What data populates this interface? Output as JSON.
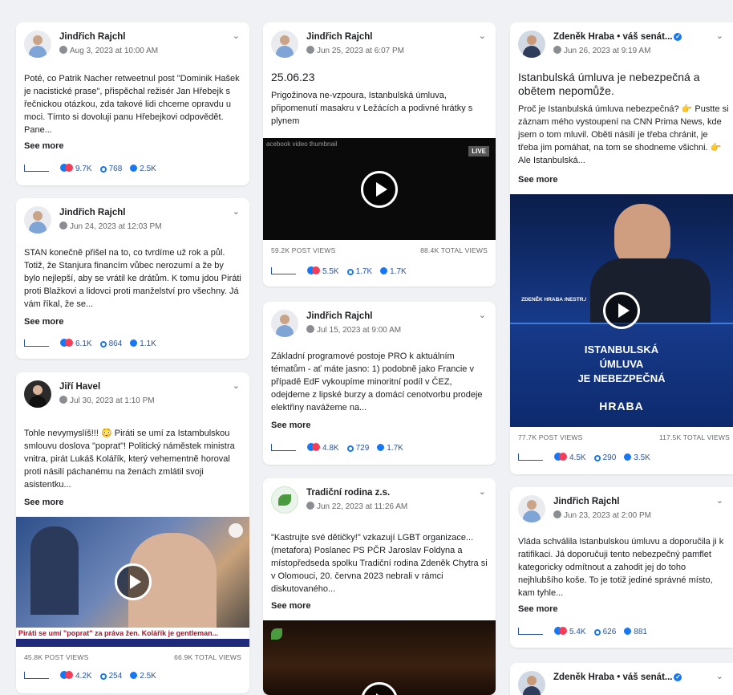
{
  "posts": [
    {
      "author": "Jindřich Rajchl",
      "date": "Aug 3, 2023 at 10:00 AM",
      "text": "Poté, co Patrik Nacher retweetnul post \"Dominik Hašek je nacistické prase\", přispěchal režisér Jan Hřebejk s řečnickou otázkou, zda takové lidi chceme opravdu u moci. Tímto si dovoluji panu Hřebejkovi odpovědět. Pane...",
      "see_more": "See more",
      "reactions": "9.7K",
      "comments": "768",
      "shares": "2.5K"
    },
    {
      "author": "Jindřich Rajchl",
      "date": "Jun 24, 2023 at 12:03 PM",
      "text": "STAN konečně přišel na to, co tvrdíme už rok a půl. Totiž, že Stanjura financím vůbec nerozumí a že by bylo nejlepší, aby se vrátil ke drátům. K tomu jdou Piráti proti Blažkovi a lidovci proti manželství pro všechny. Já vám říkal, že se...",
      "see_more": "See more",
      "reactions": "6.1K",
      "comments": "864",
      "shares": "1.1K"
    },
    {
      "author": "Jiří Havel",
      "date": "Jul 30, 2023 at 1:10 PM",
      "text": "Tohle nevymyslíš!!! 😳 Piráti se umí za Istambulskou smlouvu doslova \"poprat\"! Politický náměstek ministra vnitra, pirát Lukáš Kolářík, který vehementně horoval proti násilí páchanému na ženách zmlátil svoji asistentku...",
      "see_more": "See more",
      "caption": "Piráti se umí \"poprat\" za práva žen. Kolářík je gentleman...",
      "post_views": "45.8K POST VIEWS",
      "total_views": "66.9K TOTAL VIEWS",
      "reactions": "4.2K",
      "comments": "254",
      "shares": "2.5K"
    },
    {
      "author": "Jindřich Rajchl",
      "date": "Jun 25, 2023 at 6:07 PM",
      "title": "25.06.23",
      "text": "Prigožinova ne-vzpoura, Istanbulská úmluva, připomenutí masakru v Ležácích a podivné hrátky s plynem",
      "thumb_label": "acebook video thumbnail",
      "live": "LIVE",
      "post_views": "59.2K POST VIEWS",
      "total_views": "88.4K TOTAL VIEWS",
      "reactions": "5.5K",
      "comments": "1.7K",
      "shares": "1.7K"
    },
    {
      "author": "Jindřich Rajchl",
      "date": "Jul 15, 2023 at 9:00 AM",
      "text": "Základní programové postoje PRO k aktuálním tématům - ať máte jasno: 1) podobně jako Francie v případě EdF vykoupíme minoritní podíl v ČEZ, odejdeme z lipské burzy a domácí cenotvorbu prodeje elektřiny navážeme na...",
      "see_more": "See more",
      "reactions": "4.8K",
      "comments": "729",
      "shares": "1.7K"
    },
    {
      "author": "Tradiční rodina z.s.",
      "date": "Jun 22, 2023 at 11:26 AM",
      "text": "\"Kastrujte své dětičky!\" vzkazují LGBT organizace... (metafora) Poslanec PS PČR Jaroslav Foldyna a místopředseda spolku Tradiční rodina Zdeněk Chytra si v Olomouci, 20. června 2023 nebrali v rámci diskutovaného...",
      "see_more": "See more"
    },
    {
      "author": "Zdeněk Hraba • váš senát...",
      "date": "Jun 26, 2023 at 9:19 AM",
      "title": "Istanbulská úmluva je nebezpečná a obětem nepomůže.",
      "text": "Proč je Istanbulská úmluva nebezpečná? 👉 Pustte si záznam mého vystoupení na CNN Prima News, kde jsem o tom mluvil. Oběti násilí je třeba chránit, je třeba jim pomáhat, na tom se shodneme všichni. 👉 Ale Istanbulská...",
      "see_more": "See more",
      "lower_third": "ZDENĚK HRABA /NESTR./",
      "banner_line1": "ISTANBULSKÁ",
      "banner_line2": "ÚMLUVA",
      "banner_line3": "JE NEBEZPEČNÁ",
      "brand": "HRABA",
      "post_views": "77.7K POST VIEWS",
      "total_views": "117.5K TOTAL VIEWS",
      "reactions": "4.5K",
      "comments": "290",
      "shares": "3.5K"
    },
    {
      "author": "Jindřich Rajchl",
      "date": "Jun 23, 2023 at 2:00 PM",
      "text": "Vláda schválila Istanbulskou úmluvu a doporučila ji k ratifikaci. Já doporučuji tento nebezpečný pamflet kategoricky odmítnout a zahodit jej do toho nejhlubšího koše. To je totiž jediné správné místo, kam tyhle...",
      "see_more": "See more",
      "reactions": "5.4K",
      "comments": "626",
      "shares": "881"
    },
    {
      "author": "Zdeněk Hraba • váš senát..."
    }
  ]
}
